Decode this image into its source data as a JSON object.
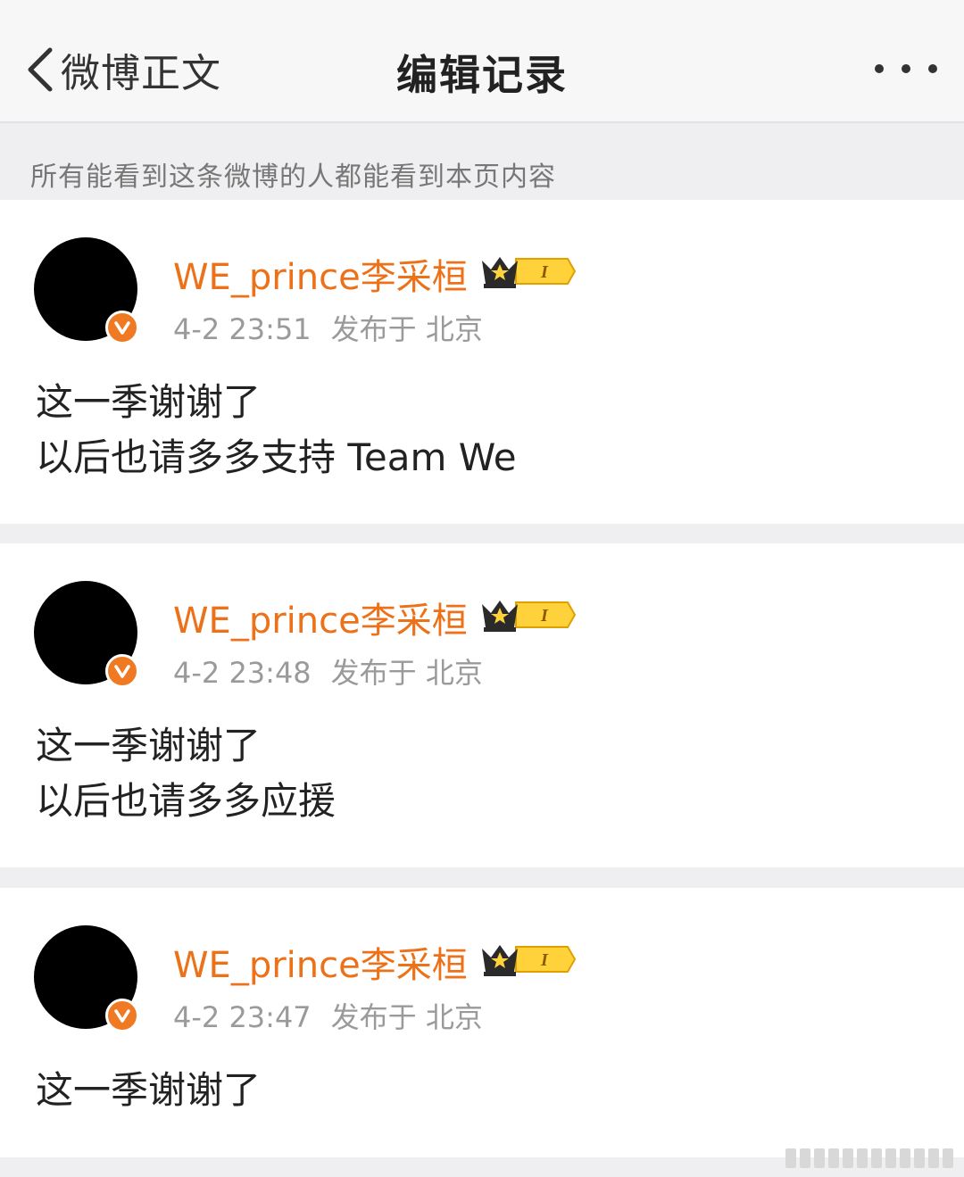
{
  "nav": {
    "back_label": "微博正文",
    "title": "编辑记录"
  },
  "notice": "所有能看到这条微博的人都能看到本页内容",
  "posts": [
    {
      "username": "WE_prince李采桓",
      "vip_level": "I",
      "time": "4-2 23:51",
      "location": "发布于 北京",
      "lines": [
        "这一季谢谢了",
        "以后也请多多支持 Team We"
      ]
    },
    {
      "username": "WE_prince李采桓",
      "vip_level": "I",
      "time": "4-2 23:48",
      "location": "发布于 北京",
      "lines": [
        "这一季谢谢了",
        "以后也请多多应援"
      ]
    },
    {
      "username": "WE_prince李采桓",
      "vip_level": "I",
      "time": "4-2 23:47",
      "location": "发布于 北京",
      "lines": [
        "这一季谢谢了"
      ]
    }
  ],
  "colors": {
    "username": "#ec7118",
    "verified_badge": "#f07a24",
    "background": "#efeff1"
  },
  "icons": {
    "back": "chevron-left-icon",
    "more": "more-dots-icon",
    "verified": "verified-v-icon",
    "vip": "vip-crown-icon"
  }
}
